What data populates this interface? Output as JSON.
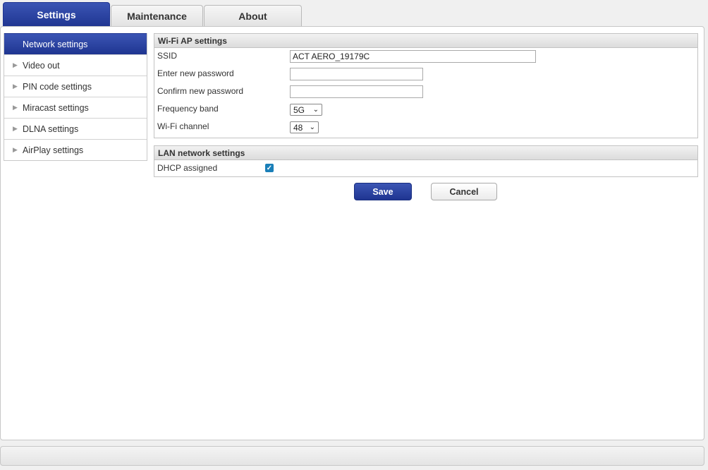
{
  "tabs": {
    "settings": "Settings",
    "maintenance": "Maintenance",
    "about": "About"
  },
  "sidebar": {
    "items": [
      {
        "label": "Network settings",
        "active": true
      },
      {
        "label": "Video out"
      },
      {
        "label": "PIN code settings"
      },
      {
        "label": "Miracast settings"
      },
      {
        "label": "DLNA settings"
      },
      {
        "label": "AirPlay settings"
      }
    ]
  },
  "wifi": {
    "title": "Wi-Fi AP settings",
    "ssid_label": "SSID",
    "ssid_value": "ACT AERO_19179C",
    "new_password_label": "Enter new password",
    "new_password_value": "",
    "confirm_password_label": "Confirm new password",
    "confirm_password_value": "",
    "frequency_label": "Frequency band",
    "frequency_value": "5G",
    "channel_label": "Wi-Fi channel",
    "channel_value": "48"
  },
  "lan": {
    "title": "LAN network settings",
    "dhcp_label": "DHCP assigned",
    "dhcp_checked": true
  },
  "actions": {
    "save": "Save",
    "cancel": "Cancel"
  },
  "colors": {
    "accent": "#1f3591",
    "checkbox": "#1a7fb8"
  }
}
